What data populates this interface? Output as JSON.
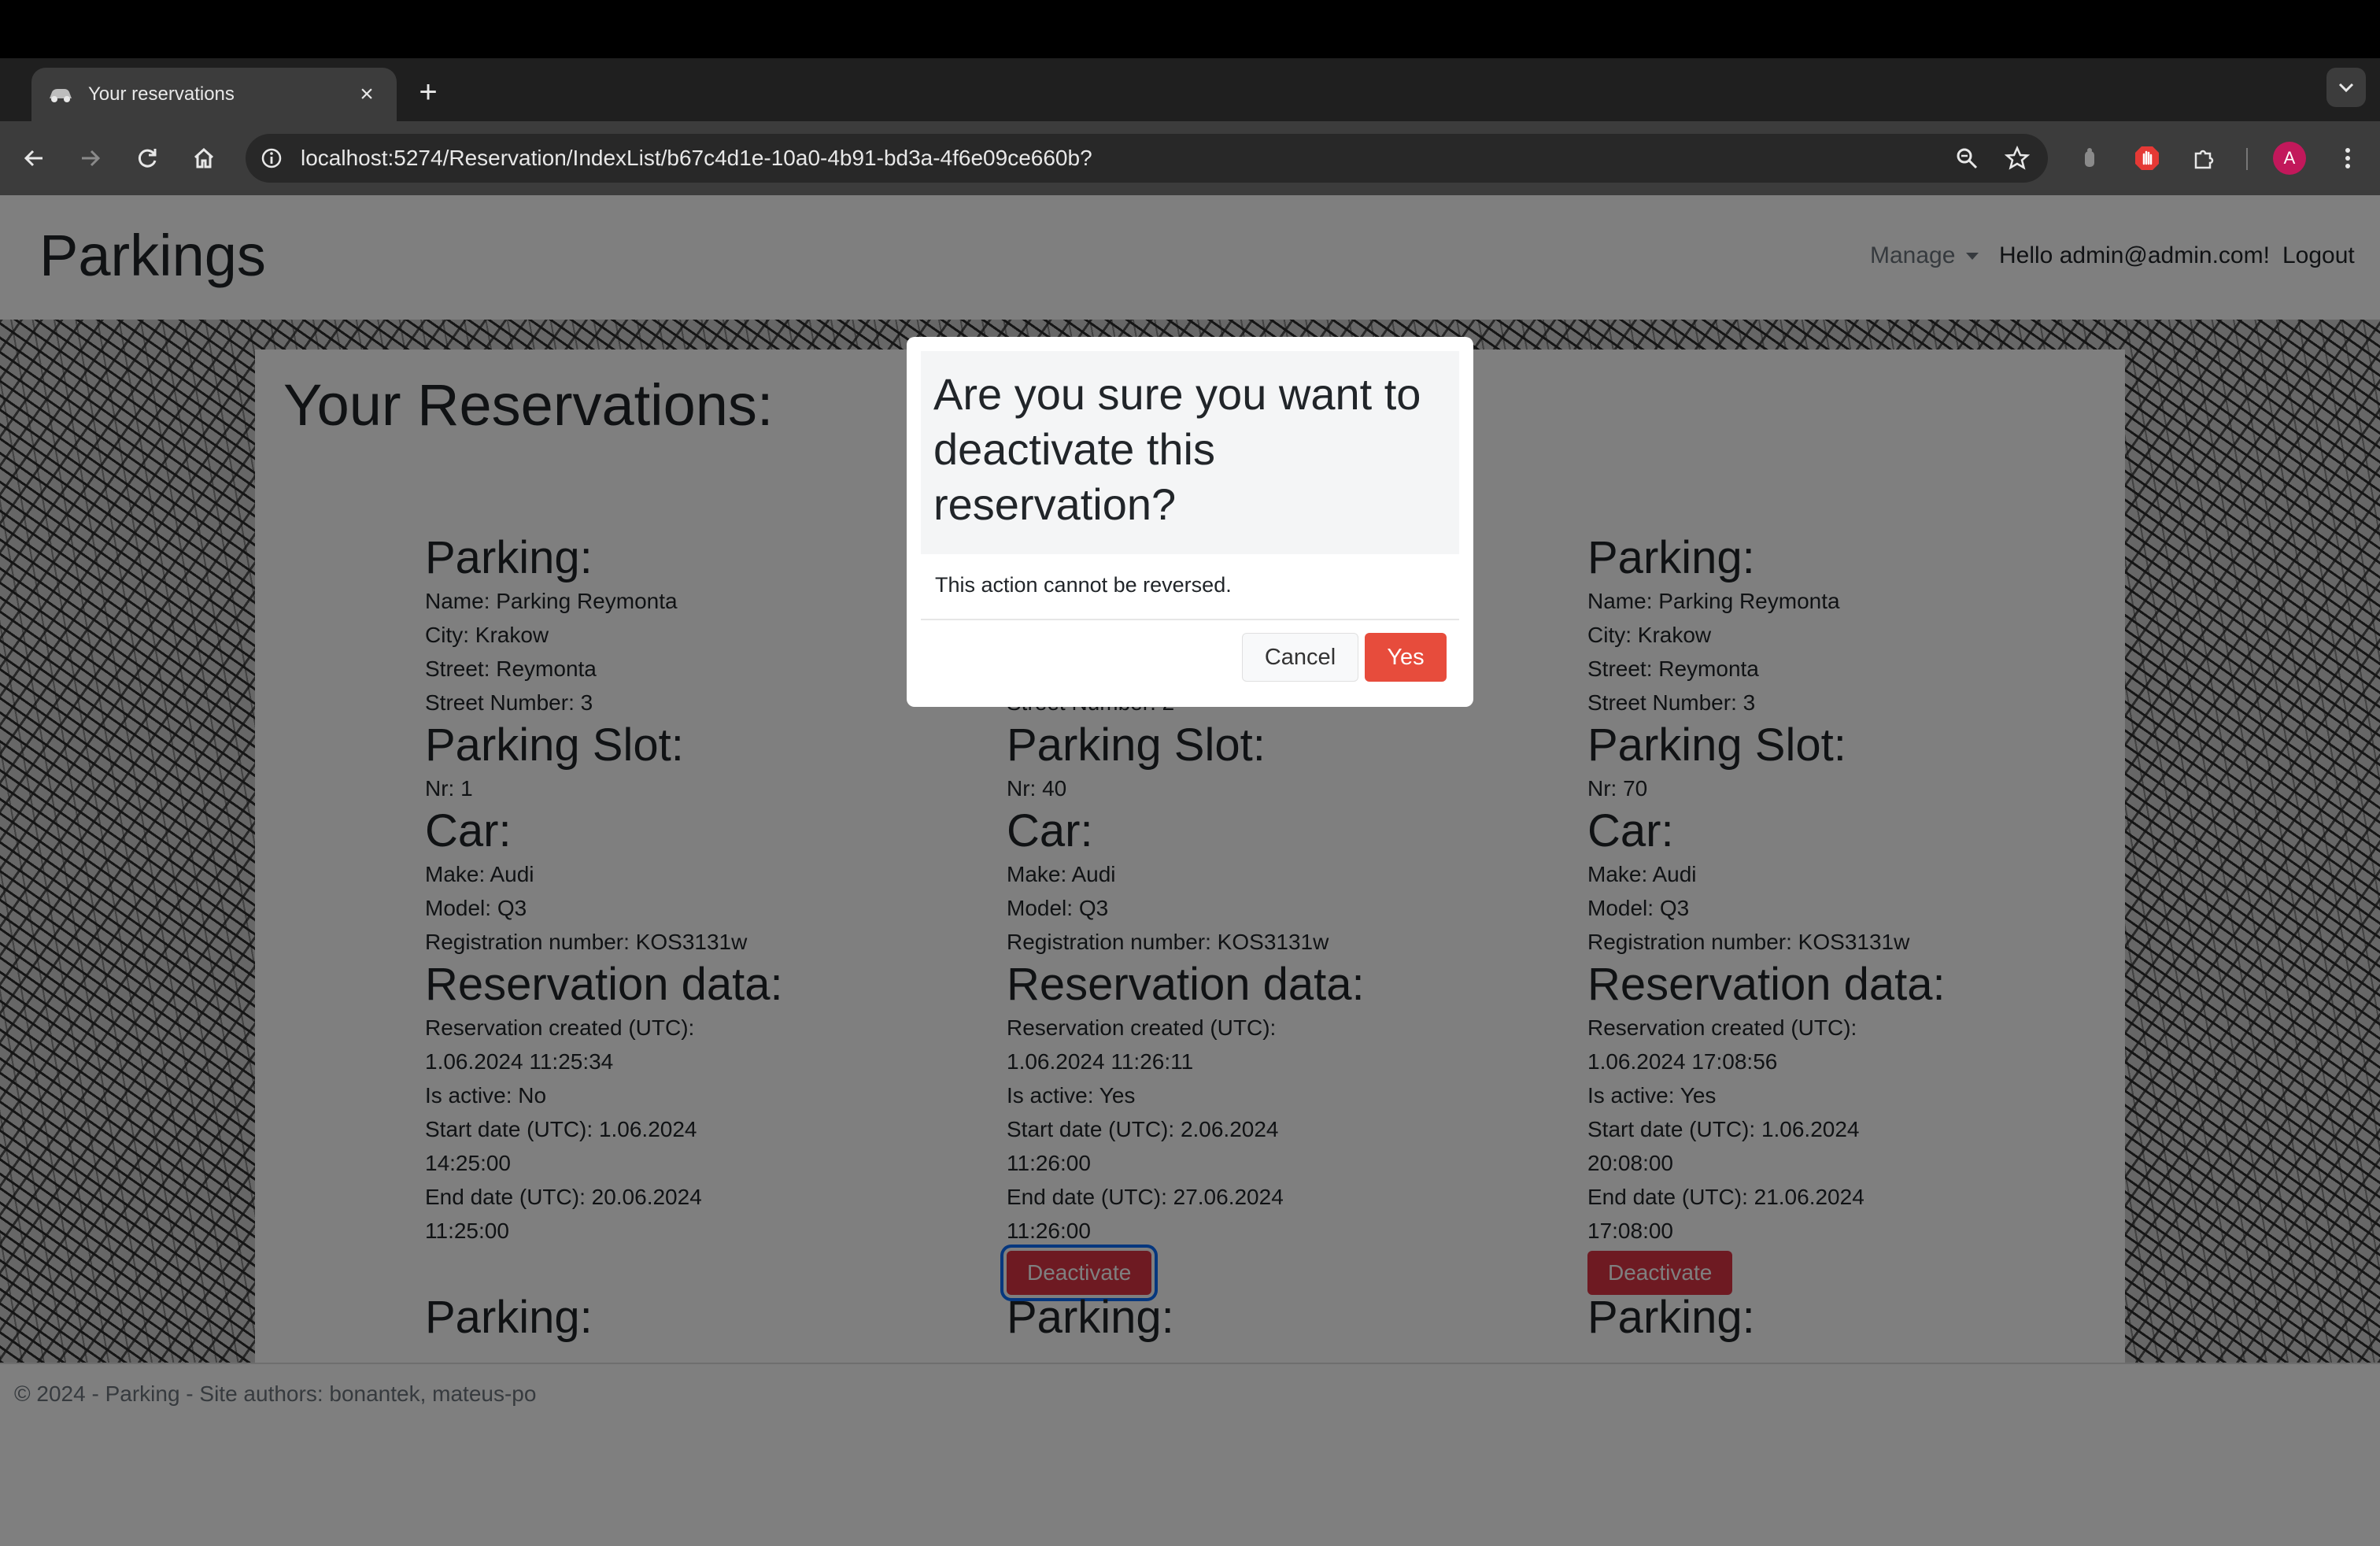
{
  "browser": {
    "tab_title": "Your reservations",
    "tab_close": "×",
    "new_tab": "+",
    "url": "localhost:5274/Reservation/IndexList/b67c4d1e-10a0-4b91-bd3a-4f6e09ce660b?",
    "avatar_letter": "A"
  },
  "header": {
    "brand": "Parkings",
    "manage": "Manage",
    "hello": "Hello admin@admin.com!",
    "logout": "Logout"
  },
  "page": {
    "title": "Your Reservations:"
  },
  "labels": {
    "parking": "Parking:",
    "slot": "Parking Slot:",
    "car": "Car:",
    "reservation": "Reservation data:"
  },
  "cards": [
    {
      "name": "Name: Parking Reymonta",
      "city": "City: Krakow",
      "street": "Street: Reymonta",
      "street_number": "Street Number: 3",
      "slot_nr": "Nr: 1",
      "make": "Make: Audi",
      "model": "Model: Q3",
      "registration": "Registration number: KOS3131w",
      "created_label": "Reservation created (UTC):",
      "created": "1.06.2024 11:25:34",
      "active": "Is active: No",
      "start_label": "Start date (UTC): 1.06.2024",
      "start_time": "14:25:00",
      "end_label": "End date (UTC): 20.06.2024",
      "end_time": "11:25:00",
      "button": ""
    },
    {
      "name": "",
      "city": "",
      "street": "",
      "street_number": "Street Number: 2",
      "slot_nr": "Nr: 40",
      "make": "Make: Audi",
      "model": "Model: Q3",
      "registration": "Registration number: KOS3131w",
      "created_label": "Reservation created (UTC):",
      "created": "1.06.2024 11:26:11",
      "active": "Is active: Yes",
      "start_label": "Start date (UTC): 2.06.2024",
      "start_time": "11:26:00",
      "end_label": "End date (UTC): 27.06.2024",
      "end_time": "11:26:00",
      "button": "Deactivate"
    },
    {
      "name": "Name: Parking Reymonta",
      "city": "City: Krakow",
      "street": "Street: Reymonta",
      "street_number": "Street Number: 3",
      "slot_nr": "Nr: 70",
      "make": "Make: Audi",
      "model": "Model: Q3",
      "registration": "Registration number: KOS3131w",
      "created_label": "Reservation created (UTC):",
      "created": "1.06.2024 17:08:56",
      "active": "Is active: Yes",
      "start_label": "Start date (UTC): 1.06.2024",
      "start_time": "20:08:00",
      "end_label": "End date (UTC): 21.06.2024",
      "end_time": "17:08:00",
      "button": "Deactivate"
    }
  ],
  "footer": {
    "text": "© 2024 - Parking - Site authors: bonantek, mateus-po"
  },
  "modal": {
    "title": "Are you sure you want to deactivate this reservation?",
    "body": "This action cannot be reversed.",
    "cancel": "Cancel",
    "yes": "Yes"
  },
  "colors": {
    "danger": "#dc3545",
    "yes": "#e74c3c",
    "focus": "#0d6efd",
    "avatar": "#c2185b"
  }
}
